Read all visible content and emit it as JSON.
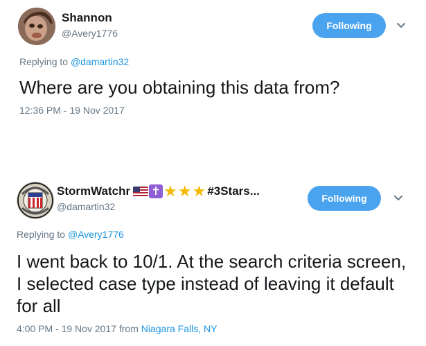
{
  "tweets": [
    {
      "name": "Shannon",
      "handle": "@Avery1776",
      "follow_label": "Following",
      "reply_prefix": "Replying to ",
      "reply_to": "@damartin32",
      "text": "Where are you obtaining this data from?",
      "timestamp": "12:36 PM - 19 Nov 2017"
    },
    {
      "name": "StormWatchr",
      "name_suffix": "#3Stars...",
      "handle": "@damartin32",
      "follow_label": "Following",
      "reply_prefix": "Replying to ",
      "reply_to": "@Avery1776",
      "text": "I went back to 10/1.  At the search criteria screen, I selected case type instead of leaving it default for all",
      "timestamp": "4:00 PM - 19 Nov 2017 from ",
      "location": "Niagara Falls, NY"
    }
  ],
  "colors": {
    "follow_button": "#4aa3ef",
    "link": "#1b95e0",
    "muted": "#657786"
  },
  "icons": [
    "chevron-down-icon",
    "us-flag-icon",
    "latin-cross-icon",
    "star-icon"
  ]
}
